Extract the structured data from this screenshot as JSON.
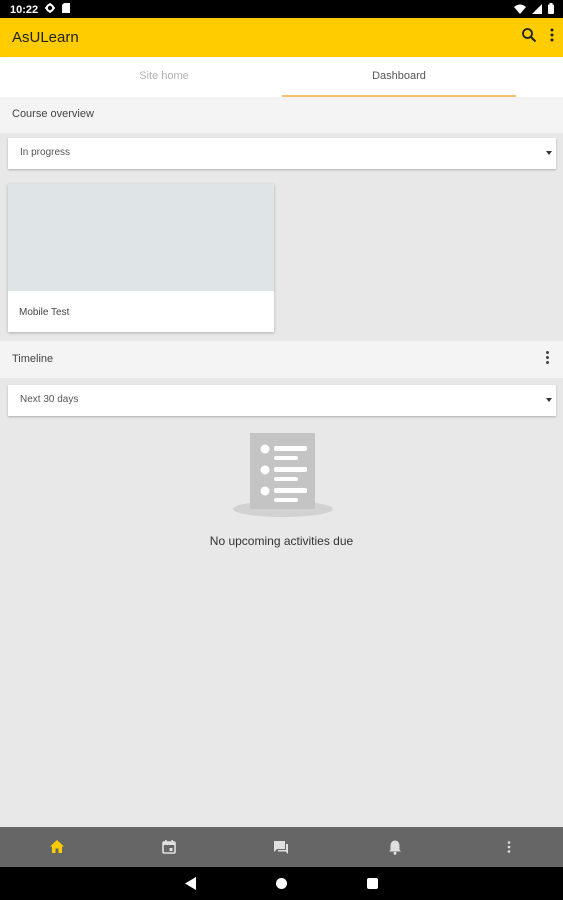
{
  "status_bar": {
    "time": "10:22",
    "icons": [
      "settings-icon",
      "sd-card-icon",
      "wifi-icon",
      "no-sim-icon",
      "battery-icon"
    ]
  },
  "app_bar": {
    "title": "AsULearn",
    "background_color": "#ffcc00",
    "icons": [
      "search-icon",
      "more-vert-icon"
    ]
  },
  "tabs": [
    {
      "label": "Site home",
      "selected": false
    },
    {
      "label": "Dashboard",
      "selected": true
    }
  ],
  "course_overview": {
    "title": "Course overview",
    "filter": {
      "selected": "In progress"
    },
    "courses": [
      {
        "title": "Mobile Test"
      }
    ]
  },
  "timeline": {
    "title": "Timeline",
    "filter": {
      "selected": "Next 30 days"
    },
    "empty_icon": "list-icon",
    "empty_message": "No upcoming activities due"
  },
  "bottom_nav": {
    "items": [
      {
        "icon": "home-icon",
        "active": true
      },
      {
        "icon": "calendar-icon",
        "active": false
      },
      {
        "icon": "messages-icon",
        "active": false
      },
      {
        "icon": "notifications-icon",
        "active": false
      },
      {
        "icon": "more-vert-icon",
        "active": false
      }
    ],
    "active_color": "#ffcc00"
  },
  "system_nav": {
    "icons": [
      "back-icon",
      "home-circle-icon",
      "recents-icon"
    ]
  }
}
